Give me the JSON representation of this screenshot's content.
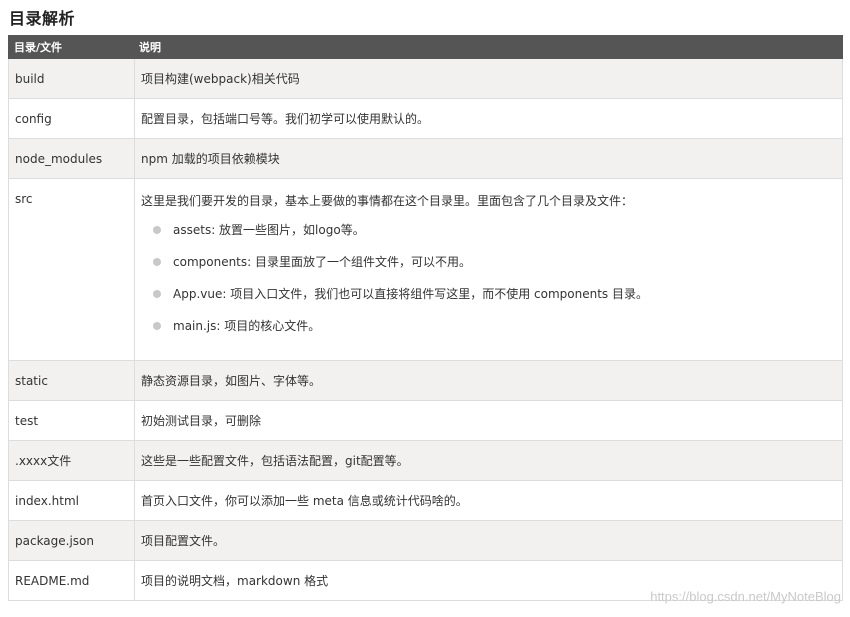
{
  "title": "目录解析",
  "table": {
    "headers": [
      "目录/文件",
      "说明"
    ],
    "rows": [
      {
        "name": "build",
        "desc": "项目构建(webpack)相关代码"
      },
      {
        "name": "config",
        "desc": "配置目录，包括端口号等。我们初学可以使用默认的。"
      },
      {
        "name": "node_modules",
        "desc": "npm 加载的项目依赖模块"
      },
      {
        "name": "src",
        "desc": "这里是我们要开发的目录，基本上要做的事情都在这个目录里。里面包含了几个目录及文件：",
        "bullets": [
          "assets: 放置一些图片，如logo等。",
          "components: 目录里面放了一个组件文件，可以不用。",
          "App.vue: 项目入口文件，我们也可以直接将组件写这里，而不使用 components 目录。",
          "main.js: 项目的核心文件。"
        ]
      },
      {
        "name": "static",
        "desc": "静态资源目录，如图片、字体等。"
      },
      {
        "name": "test",
        "desc": "初始测试目录，可删除"
      },
      {
        "name": ".xxxx文件",
        "desc": "这些是一些配置文件，包括语法配置，git配置等。"
      },
      {
        "name": "index.html",
        "desc": "首页入口文件，你可以添加一些 meta 信息或统计代码啥的。"
      },
      {
        "name": "package.json",
        "desc": "项目配置文件。"
      },
      {
        "name": "README.md",
        "desc": "项目的说明文档，markdown 格式"
      }
    ]
  },
  "watermark": "https://blog.csdn.net/MyNoteBlog"
}
